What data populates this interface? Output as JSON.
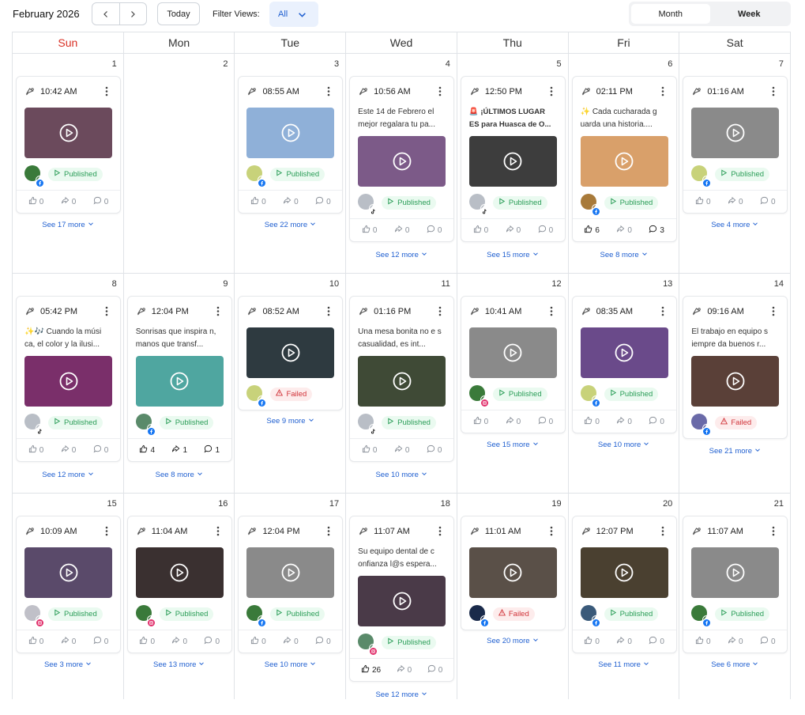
{
  "header": {
    "month_title": "February 2026",
    "today_label": "Today",
    "filter_label": "Filter Views:",
    "filter_value": "All",
    "view_month": "Month",
    "view_week": "Week",
    "active_view": "Month"
  },
  "weekdays": [
    "Sun",
    "Mon",
    "Tue",
    "Wed",
    "Thu",
    "Fri",
    "Sat"
  ],
  "colors": {
    "accent": "#1f5fd0",
    "published": "#2a9d57",
    "failed": "#d1343a",
    "sunday": "#d93025"
  },
  "weeks": [
    [
      {
        "date": "1",
        "post": {
          "time": "10:42 AM",
          "text": "",
          "thumb": "#6b4a5c",
          "avatar": "#3a7a3a",
          "network": "facebook",
          "status": "Published",
          "likes": "0",
          "shares": "0",
          "comments": "0"
        },
        "see_more": "See 17 more"
      },
      {
        "date": "2",
        "post": null,
        "see_more": ""
      },
      {
        "date": "3",
        "post": {
          "time": "08:55 AM",
          "text": "",
          "thumb": "#8fb0d8",
          "avatar": "#c8d27a",
          "network": "facebook",
          "status": "Published",
          "likes": "0",
          "shares": "0",
          "comments": "0"
        },
        "see_more": "See 22 more"
      },
      {
        "date": "4",
        "post": {
          "time": "10:56 AM",
          "text": "Este 14 de Febrero el mejor regalara tu pa...",
          "bold_prefix": true,
          "thumb": "#7c5a88",
          "avatar": "#b9bec6",
          "network": "tiktok",
          "status": "Published",
          "likes": "0",
          "shares": "0",
          "comments": "0"
        },
        "see_more": "See 12 more"
      },
      {
        "date": "5",
        "post": {
          "time": "12:50 PM",
          "text": "🚨 ¡ÚLTIMOS LUGAR ES para Huasca de O...",
          "bold": true,
          "thumb": "#3d3d3d",
          "avatar": "#b9bec6",
          "network": "tiktok",
          "status": "Published",
          "likes": "0",
          "shares": "0",
          "comments": "0"
        },
        "see_more": "See 15 more"
      },
      {
        "date": "6",
        "post": {
          "time": "02:11 PM",
          "text": "✨ Cada cucharada g uarda una historia....",
          "thumb": "#d9a06a",
          "avatar": "#a87a3a",
          "network": "facebook",
          "status": "Published",
          "likes": "6",
          "shares": "0",
          "comments": "3"
        },
        "see_more": "See 8 more"
      },
      {
        "date": "7",
        "post": {
          "time": "01:16 AM",
          "text": "",
          "thumb": "#8a8a8a",
          "avatar": "#c8d27a",
          "network": "facebook",
          "status": "Published",
          "likes": "0",
          "shares": "0",
          "comments": "0"
        },
        "see_more": "See 4 more"
      }
    ],
    [
      {
        "date": "8",
        "post": {
          "time": "05:42 PM",
          "text": "✨🎶 Cuando la músi ca, el color y la ilusi...",
          "thumb": "#7a2f6a",
          "avatar": "#b9bec6",
          "network": "tiktok",
          "status": "Published",
          "likes": "0",
          "shares": "0",
          "comments": "0"
        },
        "see_more": "See 12 more"
      },
      {
        "date": "9",
        "post": {
          "time": "12:04 PM",
          "text": "Sonrisas que inspira n, manos que transf...",
          "thumb": "#4fa6a0",
          "avatar": "#5a8a6a",
          "network": "facebook",
          "status": "Published",
          "likes": "4",
          "shares": "1",
          "comments": "1"
        },
        "see_more": "See 8 more"
      },
      {
        "date": "10",
        "post": {
          "time": "08:52 AM",
          "text": "",
          "thumb": "#2e3a40",
          "avatar": "#c8d27a",
          "network": "facebook",
          "status": "Failed",
          "likes": "",
          "shares": "",
          "comments": ""
        },
        "see_more": "See 9 more"
      },
      {
        "date": "11",
        "post": {
          "time": "01:16 PM",
          "text": "Una mesa bonita no e s casualidad, es int...",
          "thumb": "#3f4a36",
          "avatar": "#b9bec6",
          "network": "tiktok",
          "status": "Published",
          "likes": "0",
          "shares": "0",
          "comments": "0"
        },
        "see_more": "See 10 more"
      },
      {
        "date": "12",
        "post": {
          "time": "10:41 AM",
          "text": "",
          "thumb": "#8a8a8a",
          "avatar": "#3a7a3a",
          "network": "instagram",
          "status": "Published",
          "likes": "0",
          "shares": "0",
          "comments": "0"
        },
        "see_more": "See 15 more"
      },
      {
        "date": "13",
        "post": {
          "time": "08:35 AM",
          "text": "",
          "thumb": "#6a4a8a",
          "avatar": "#c8d27a",
          "network": "facebook",
          "status": "Published",
          "likes": "0",
          "shares": "0",
          "comments": "0"
        },
        "see_more": "See 10 more"
      },
      {
        "date": "14",
        "post": {
          "time": "09:16 AM",
          "text": "El trabajo en equipo s iempre da buenos r...",
          "thumb": "#5a4038",
          "avatar": "#6a6aa8",
          "network": "facebook",
          "status": "Failed",
          "likes": "",
          "shares": "",
          "comments": ""
        },
        "see_more": "See 21 more"
      }
    ],
    [
      {
        "date": "15",
        "post": {
          "time": "10:09 AM",
          "text": "",
          "thumb": "#5a4a6a",
          "avatar": "#c0c0c8",
          "network": "instagram",
          "status": "Published",
          "likes": "0",
          "shares": "0",
          "comments": "0"
        },
        "see_more": "See 3 more"
      },
      {
        "date": "16",
        "post": {
          "time": "11:04 AM",
          "text": "",
          "thumb": "#3a3030",
          "avatar": "#3a7a3a",
          "network": "instagram",
          "status": "Published",
          "likes": "0",
          "shares": "0",
          "comments": "0"
        },
        "see_more": "See 13 more"
      },
      {
        "date": "17",
        "post": {
          "time": "12:04 PM",
          "text": "",
          "thumb": "#8a8a8a",
          "avatar": "#3a7a3a",
          "network": "facebook",
          "status": "Published",
          "likes": "0",
          "shares": "0",
          "comments": "0"
        },
        "see_more": "See 10 more"
      },
      {
        "date": "18",
        "post": {
          "time": "11:07 AM",
          "text": "Su equipo dental de c onfianza l@s espera...",
          "thumb": "#4a3a48",
          "avatar": "#5a8a6a",
          "network": "instagram",
          "status": "Published",
          "likes": "26",
          "shares": "0",
          "comments": "0"
        },
        "see_more": "See 12 more"
      },
      {
        "date": "19",
        "post": {
          "time": "11:01 AM",
          "text": "",
          "thumb": "#5a5048",
          "avatar": "#1a2a4a",
          "network": "facebook",
          "status": "Failed",
          "likes": "",
          "shares": "",
          "comments": ""
        },
        "see_more": "See 20 more"
      },
      {
        "date": "20",
        "post": {
          "time": "12:07 PM",
          "text": "",
          "thumb": "#4a4030",
          "avatar": "#3a5a7a",
          "network": "facebook",
          "status": "Published",
          "likes": "0",
          "shares": "0",
          "comments": "0"
        },
        "see_more": "See 11 more"
      },
      {
        "date": "21",
        "post": {
          "time": "11:07 AM",
          "text": "",
          "thumb": "#8a8a8a",
          "avatar": "#3a7a3a",
          "network": "facebook",
          "status": "Published",
          "likes": "0",
          "shares": "0",
          "comments": "0"
        },
        "see_more": "See 6 more"
      }
    ]
  ]
}
